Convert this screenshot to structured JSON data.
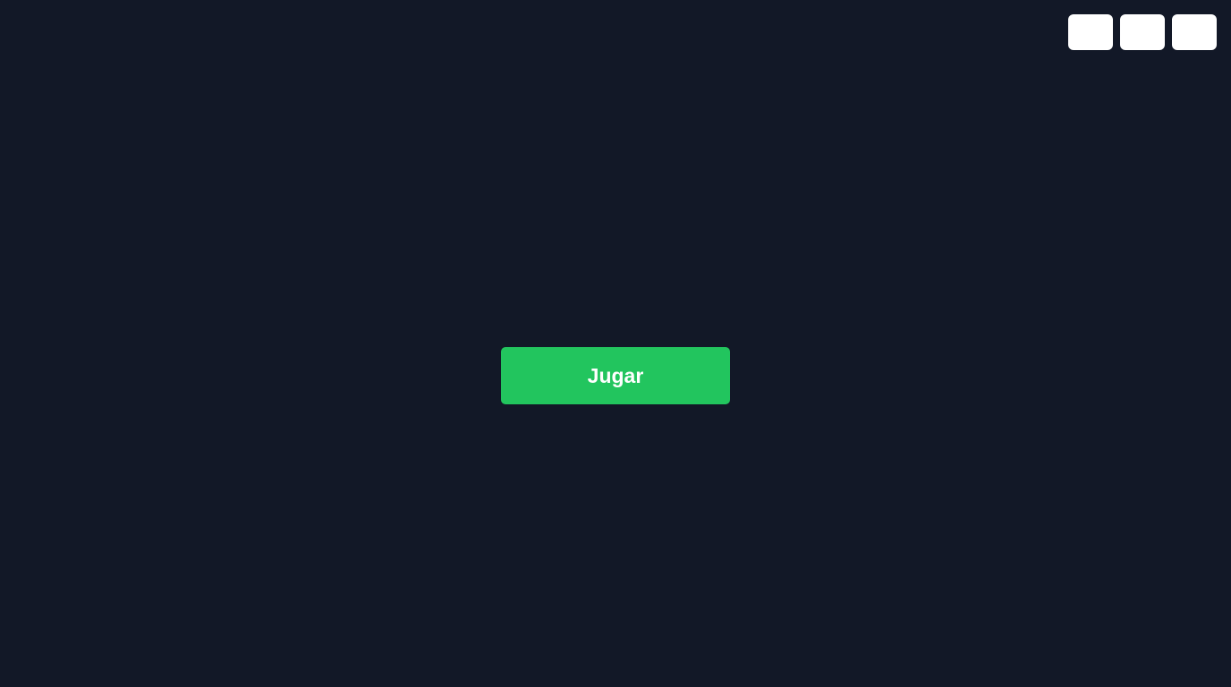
{
  "theme": {
    "background": "#121827",
    "accent": "#22c55e",
    "control_color": "#ffffff"
  },
  "main": {
    "play_label": "Jugar"
  },
  "top_controls": [
    {
      "icon": "blank-control"
    },
    {
      "icon": "blank-control"
    },
    {
      "icon": "blank-control"
    }
  ]
}
